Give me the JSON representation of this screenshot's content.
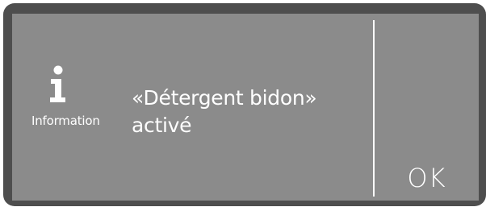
{
  "dialog": {
    "type_label": "Information",
    "icon": "info-icon",
    "message_line1": "«Détergent bidon»",
    "message_line2": "activé",
    "ok_label": "OK"
  },
  "colors": {
    "bezel": "#4e4e4e",
    "screen": "#8b8b8b",
    "text": "#ffffff"
  }
}
